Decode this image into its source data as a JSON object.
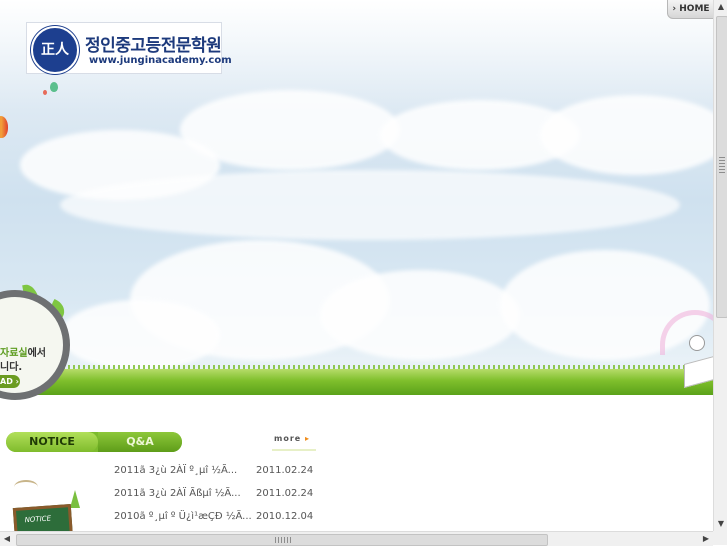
{
  "header": {
    "logo_seal_text": "正人",
    "logo_title": "정인중고등전문학원",
    "logo_url": "www.junginacademy.com",
    "home_label": "› HOME"
  },
  "banner": {
    "magnifier_line1_green": "자료실",
    "magnifier_line1_rest": "에서",
    "magnifier_line2": "니다.",
    "magnifier_button": "AD ›"
  },
  "board": {
    "tabs": [
      {
        "label": "NOTICE"
      },
      {
        "label": "Q&A"
      }
    ],
    "more_label": "more",
    "more_arrow": "▸",
    "illustration_label": "NOTICE",
    "items": [
      {
        "title": "2011ã 3¿ù 2ÀÏ º¸µî ½Ã...",
        "date": "2011.02.24"
      },
      {
        "title": "2011ã 3¿ù 2ÀÏ Ãßµî ½Ã...",
        "date": "2011.02.24"
      },
      {
        "title": "2010ã º¸µî º Ü¿ì¹æÇÐ ½Ã...",
        "date": "2010.12.04"
      }
    ]
  },
  "scrollbars": {
    "up": "▲",
    "down": "▼",
    "left": "◀",
    "right": "▶"
  },
  "colors": {
    "brand_blue": "#1d3a7c",
    "tab_green": "#7fbb2c",
    "more_orange": "#f08c1a"
  }
}
